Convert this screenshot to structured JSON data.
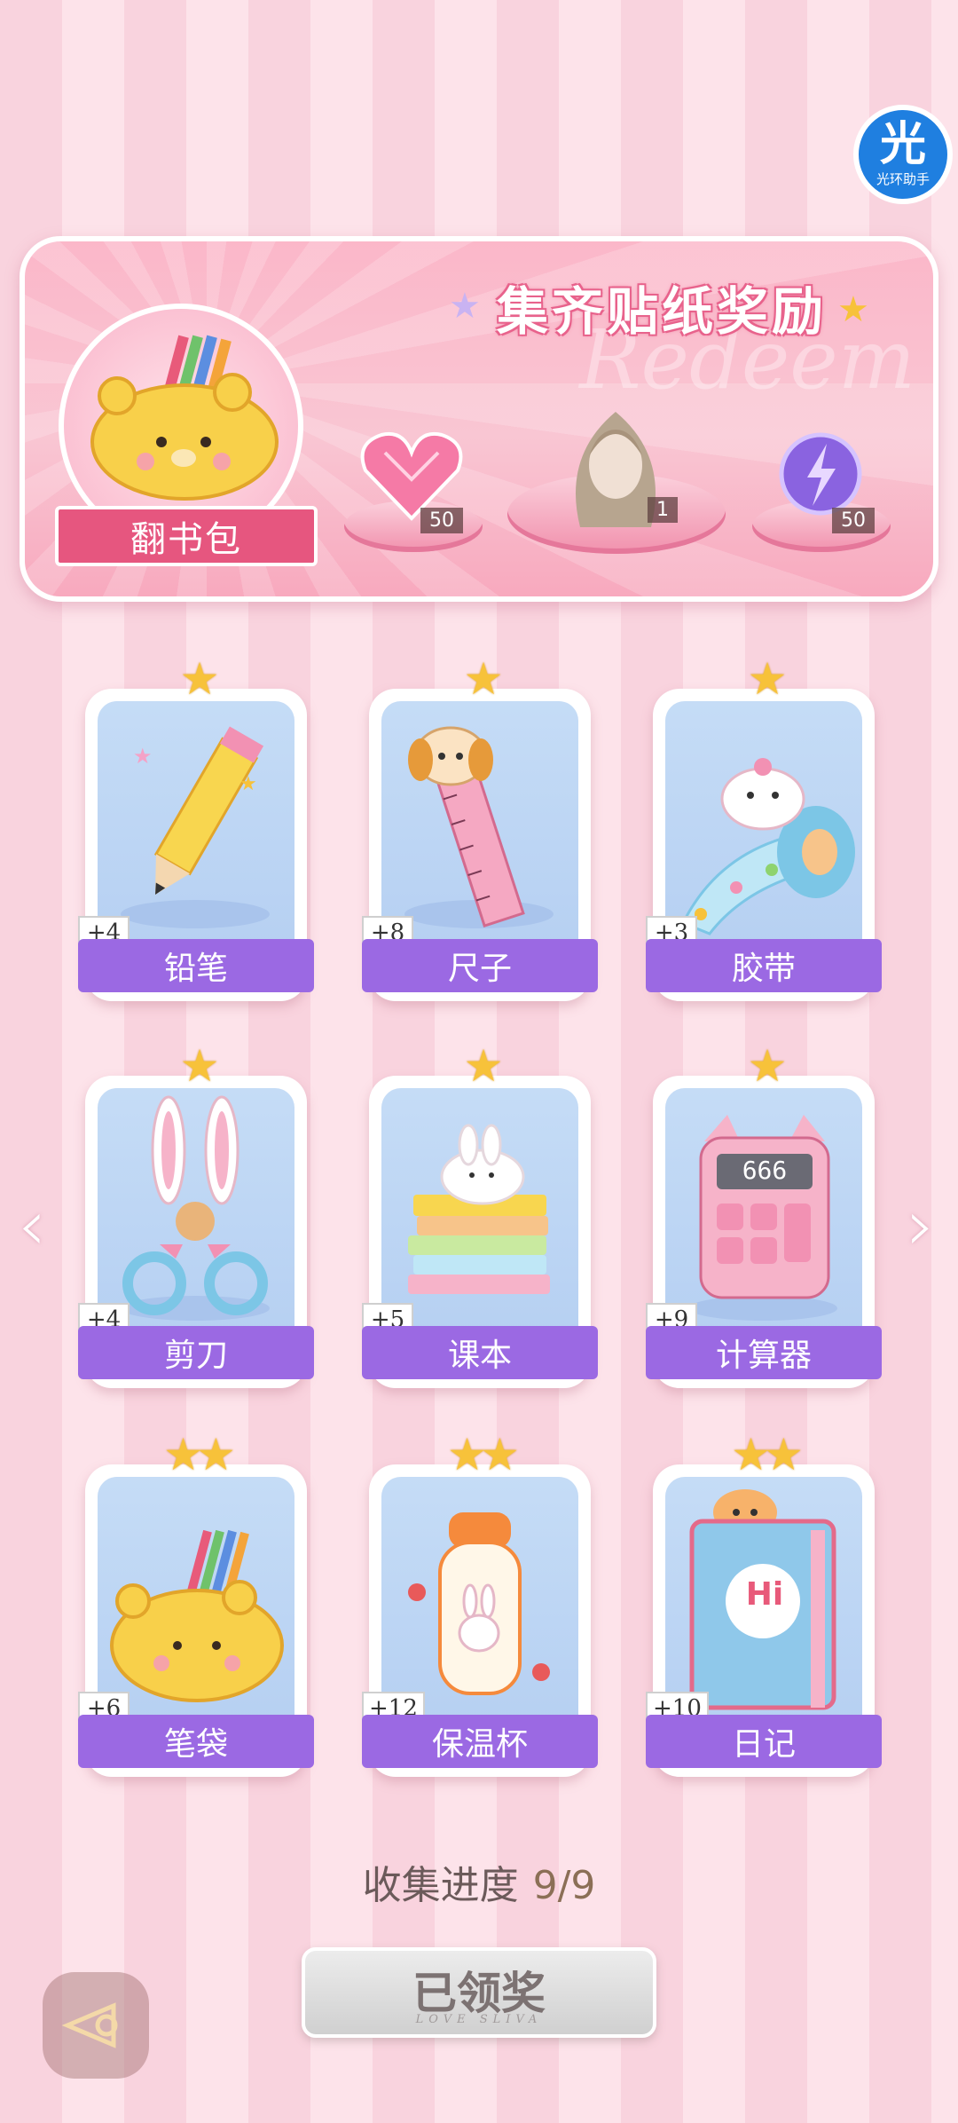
{
  "helper": {
    "glyph": "光",
    "label": "光环助手"
  },
  "banner": {
    "title": "集齐贴纸奖励",
    "watermark": "Redeem",
    "main_item": "翻书包",
    "rewards": [
      {
        "icon": "pink-heart-gem-icon",
        "count": "50"
      },
      {
        "icon": "hair-outfit-icon",
        "count": "1"
      },
      {
        "icon": "purple-energy-orb-icon",
        "count": "50"
      }
    ]
  },
  "stickers": [
    {
      "name": "铅笔",
      "bonus": "+4",
      "stars": "★"
    },
    {
      "name": "尺子",
      "bonus": "+8",
      "stars": "★"
    },
    {
      "name": "胶带",
      "bonus": "+3",
      "stars": "★"
    },
    {
      "name": "剪刀",
      "bonus": "+4",
      "stars": "★"
    },
    {
      "name": "课本",
      "bonus": "+5",
      "stars": "★"
    },
    {
      "name": "计算器",
      "bonus": "+9",
      "stars": "★"
    },
    {
      "name": "笔袋",
      "bonus": "+6",
      "stars": "★★"
    },
    {
      "name": "保温杯",
      "bonus": "+12",
      "stars": "★★"
    },
    {
      "name": "日记",
      "bonus": "+10",
      "stars": "★★"
    }
  ],
  "calculator_display": "666",
  "diary_text": "Hi",
  "progress": {
    "label": "收集进度",
    "value": "9/9"
  },
  "claim_button": {
    "label": "已领奖",
    "sub": "LOVE SLIVA"
  },
  "nav": {
    "prev": "‹",
    "next": "›"
  },
  "colors": {
    "accent": "#9b69e3",
    "pink": "#e6567f",
    "star": "#f7c23a"
  }
}
